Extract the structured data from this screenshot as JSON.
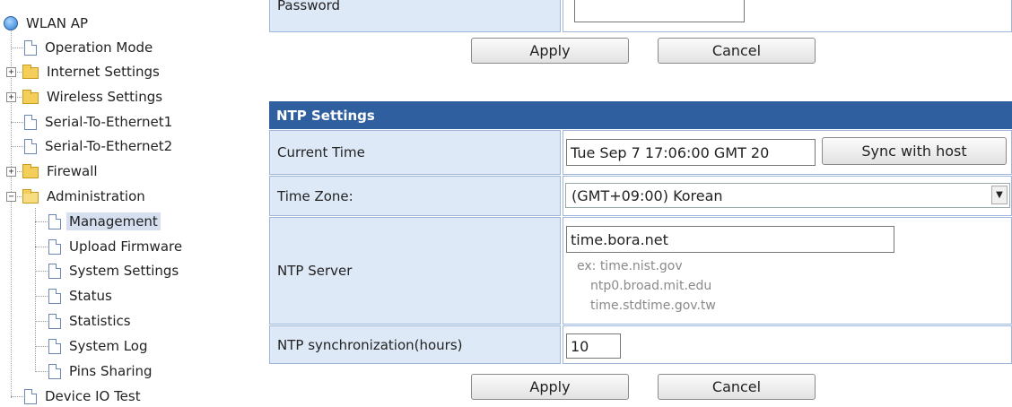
{
  "tree": {
    "root": "WLAN AP",
    "items": {
      "operation_mode": "Operation Mode",
      "internet_settings": "Internet Settings",
      "wireless_settings": "Wireless Settings",
      "serial1": "Serial-To-Ethernet1",
      "serial2": "Serial-To-Ethernet2",
      "firewall": "Firewall",
      "administration": "Administration",
      "management": "Management",
      "upload_firmware": "Upload Firmware",
      "system_settings": "System Settings",
      "status": "Status",
      "statistics": "Statistics",
      "system_log": "System Log",
      "pins_sharing": "Pins Sharing",
      "device_io_test": "Device IO Test"
    }
  },
  "top": {
    "password_label": "Password",
    "apply": "Apply",
    "cancel": "Cancel"
  },
  "ntp": {
    "title": "NTP Settings",
    "current_time_label": "Current Time",
    "current_time_value": "Tue Sep  7 17:06:00 GMT 20",
    "sync_button": "Sync with host",
    "timezone_label": "Time Zone:",
    "timezone_value": "(GMT+09:00) Korean",
    "server_label": "NTP Server",
    "server_value": "time.bora.net",
    "server_hint_1": "ex: time.nist.gov",
    "server_hint_2": "ntp0.broad.mit.edu",
    "server_hint_3": "time.stdtime.gov.tw",
    "sync_hours_label": "NTP synchronization(hours)",
    "sync_hours_value": "10",
    "apply": "Apply",
    "cancel": "Cancel"
  },
  "colors": {
    "header_bg": "#2f5f9f",
    "label_bg": "#dde9f7",
    "selected_bg": "#d6dfef"
  }
}
